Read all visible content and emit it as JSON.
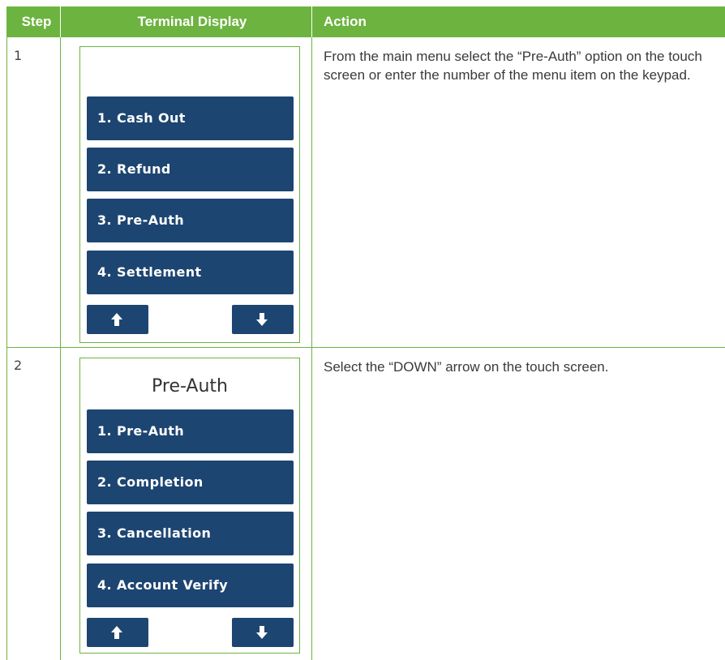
{
  "header": {
    "step": "Step",
    "terminal_display": "Terminal Display",
    "action": "Action"
  },
  "rows": [
    {
      "step": "1",
      "screen_title": "",
      "menu_items": [
        "1. Cash Out",
        "2. Refund",
        "3. Pre-Auth",
        "4. Settlement"
      ],
      "action": "From the main menu select the “Pre-Auth” option on the touch screen or enter the number of the menu item on the keypad."
    },
    {
      "step": "2",
      "screen_title": "Pre-Auth",
      "menu_items": [
        "1. Pre-Auth",
        "2. Completion",
        "3. Cancellation",
        "4. Account Verify"
      ],
      "action": "Select the “DOWN” arrow on the touch screen."
    }
  ],
  "icons": {
    "up": "arrow-up-icon",
    "down": "arrow-down-icon"
  },
  "colors": {
    "header_green": "#6cb33f",
    "button_navy": "#1d4571"
  }
}
